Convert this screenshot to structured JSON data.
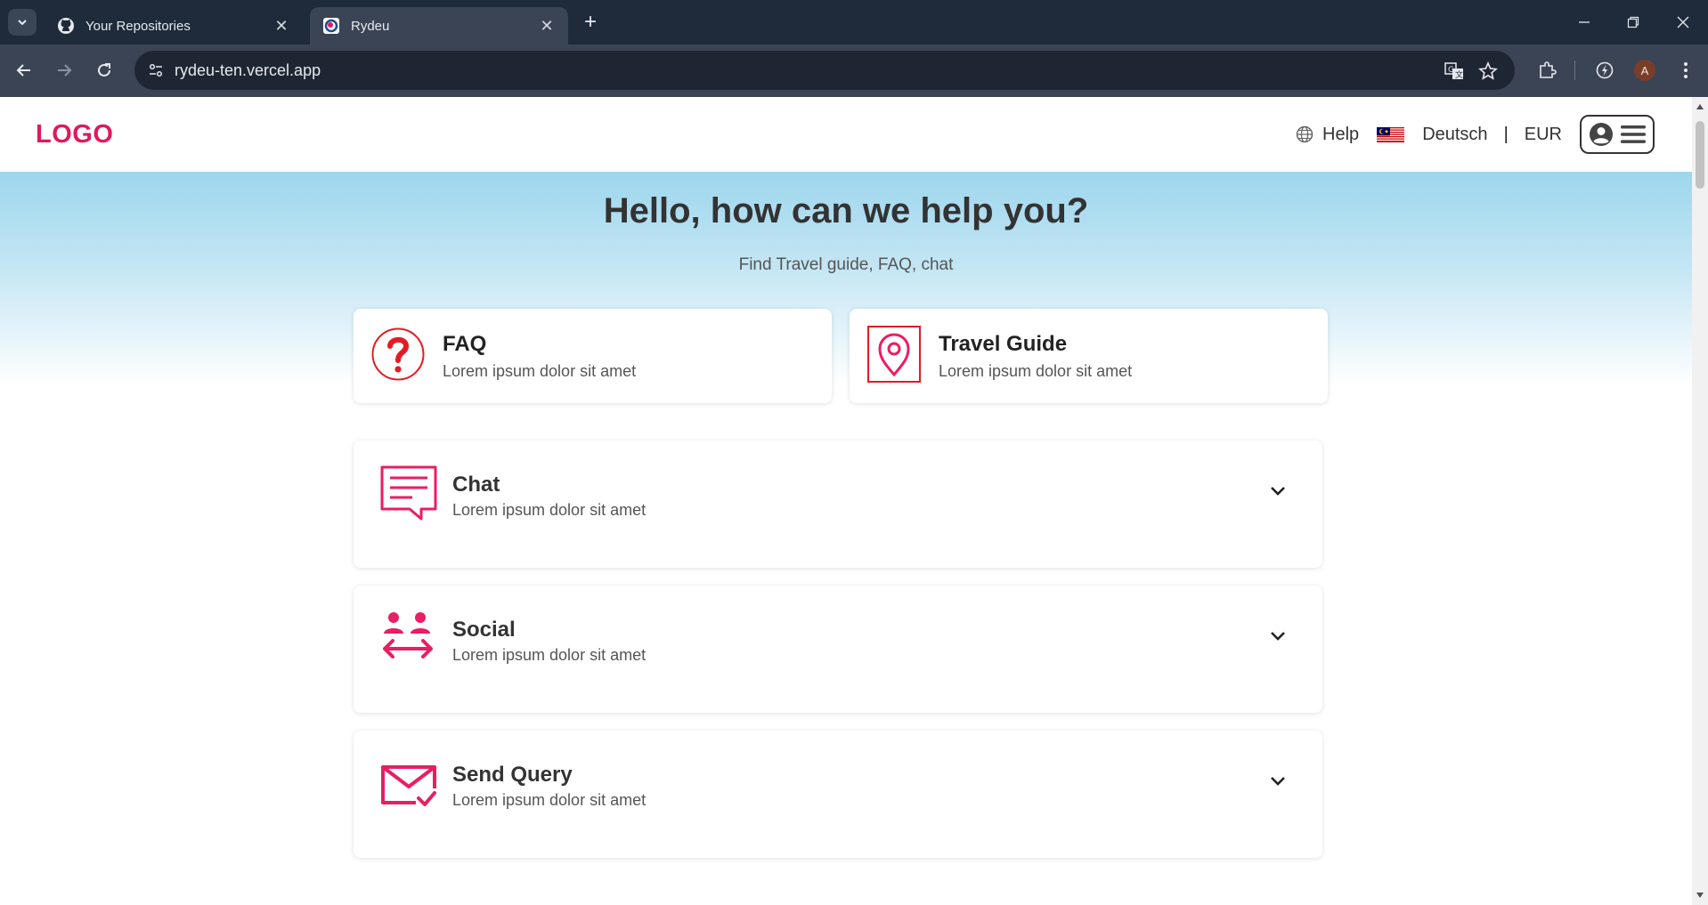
{
  "browser": {
    "tabs": [
      {
        "title": "Your Repositories",
        "favicon": "github-icon",
        "active": false
      },
      {
        "title": "Rydeu",
        "favicon": "rydeu-icon",
        "active": true
      }
    ],
    "url": "rydeu-ten.vercel.app",
    "profile_initial": "A"
  },
  "header": {
    "logo": "LOGO",
    "help_label": "Help",
    "language": "Deutsch",
    "separator": "|",
    "currency": "EUR"
  },
  "hero": {
    "title": "Hello, how can we help you?",
    "subtitle": "Find Travel guide, FAQ, chat"
  },
  "cards": [
    {
      "title": "FAQ",
      "description": "Lorem ipsum dolor sit amet",
      "icon": "question-icon"
    },
    {
      "title": "Travel Guide",
      "description": "Lorem ipsum dolor sit amet",
      "icon": "location-pin-icon"
    }
  ],
  "accordion": [
    {
      "title": "Chat",
      "description": "Lorem ipsum dolor sit amet",
      "icon": "chat-icon"
    },
    {
      "title": "Social",
      "description": "Lorem ipsum dolor sit amet",
      "icon": "people-exchange-icon"
    },
    {
      "title": "Send Query",
      "description": "Lorem ipsum dolor sit amet",
      "icon": "mail-check-icon"
    }
  ],
  "colors": {
    "brand": "#e0195e",
    "icon_pink": "#e91e63",
    "faq_red": "#e31b23",
    "text_dark": "#333333"
  }
}
